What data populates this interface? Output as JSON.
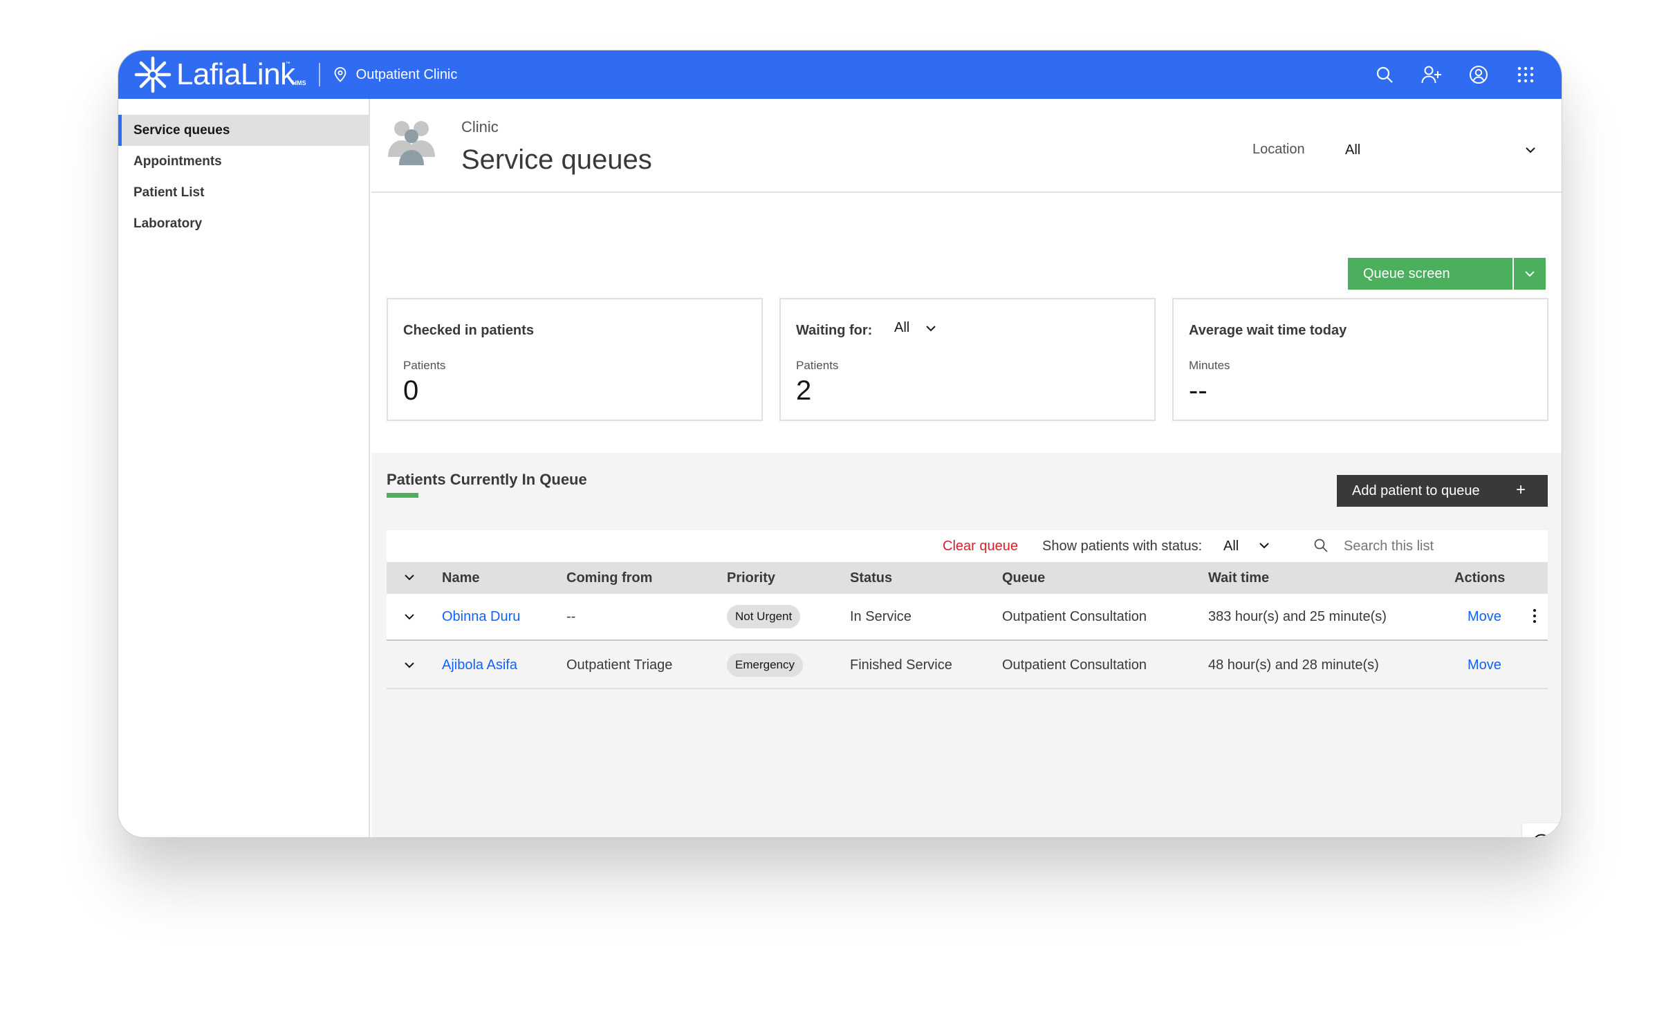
{
  "brand": {
    "name": "LafiaLink",
    "sub": "HMS",
    "tm": "™",
    "color": "#2f6cf2"
  },
  "topbar": {
    "location": "Outpatient Clinic",
    "icons": [
      "search-icon",
      "add-user-icon",
      "user-avatar-icon",
      "app-switcher-icon"
    ]
  },
  "sidebar": {
    "items": [
      {
        "label": "Service queues",
        "active": true
      },
      {
        "label": "Appointments",
        "active": false
      },
      {
        "label": "Patient List",
        "active": false
      },
      {
        "label": "Laboratory",
        "active": false
      }
    ]
  },
  "header": {
    "subtitle": "Clinic",
    "title": "Service queues",
    "location_label": "Location",
    "location_value": "All"
  },
  "queue_screen_button": {
    "label": "Queue screen",
    "color": "#4caf5d"
  },
  "tiles": [
    {
      "title": "Checked in patients",
      "sub": "Patients",
      "value": "0"
    },
    {
      "title": "Waiting for:",
      "filter": "All",
      "sub": "Patients",
      "value": "2"
    },
    {
      "title": "Average wait time today",
      "sub": "Minutes",
      "value": "--"
    }
  ],
  "queue": {
    "title": "Patients Currently In Queue",
    "add_button": "Add patient to queue",
    "add_icon": "+",
    "clear_label": "Clear queue",
    "status_filter_label": "Show patients with status:",
    "status_filter_value": "All",
    "search_placeholder": "Search this list",
    "columns": [
      "Name",
      "Coming from",
      "Priority",
      "Status",
      "Queue",
      "Wait time",
      "Actions"
    ],
    "rows": [
      {
        "name": "Obinna Duru",
        "coming_from": "--",
        "priority": "Not Urgent",
        "status": "In Service",
        "queue": "Outpatient Consultation",
        "wait_time": "383 hour(s) and 25 minute(s)",
        "action": "Move"
      },
      {
        "name": "Ajibola Asifa",
        "coming_from": "Outpatient Triage",
        "priority": "Emergency",
        "status": "Finished Service",
        "queue": "Outpatient Consultation",
        "wait_time": "48 hour(s) and 28 minute(s)",
        "action": "Move"
      }
    ]
  }
}
